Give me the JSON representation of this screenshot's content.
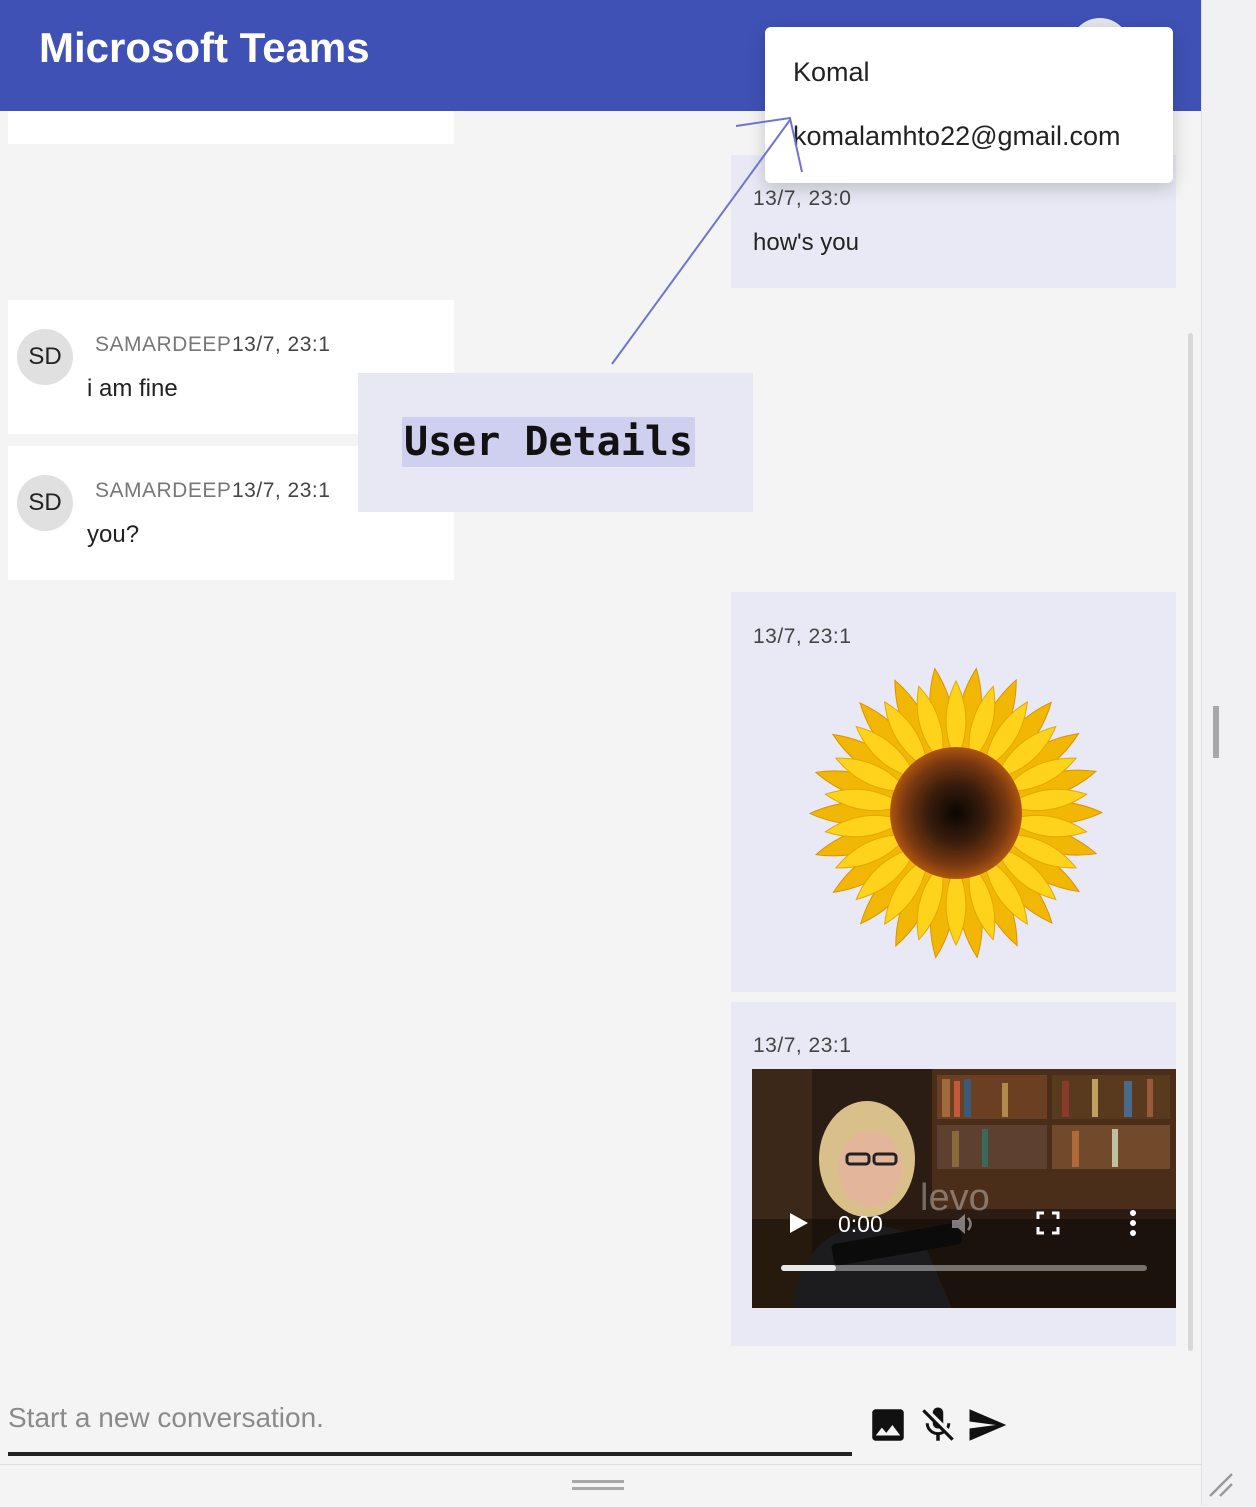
{
  "header": {
    "title": "Microsoft Teams"
  },
  "user_popup": {
    "name": "Komal",
    "email": "komalamhto22@gmail.com"
  },
  "annotation": {
    "label": "User Details"
  },
  "messages": [
    {
      "direction": "outgoing",
      "time": "13/7, 23:0",
      "text": "how's you"
    },
    {
      "direction": "incoming",
      "initials": "SD",
      "sender": "SAMARDEEP",
      "time": "13/7, 23:1",
      "text": "i am fine"
    },
    {
      "direction": "incoming",
      "initials": "SD",
      "sender": "SAMARDEEP",
      "time": "13/7, 23:1",
      "text": "you?"
    },
    {
      "direction": "outgoing",
      "time": "13/7, 23:1",
      "attachment": "sunflower-image"
    },
    {
      "direction": "outgoing",
      "time": "13/7, 23:1",
      "attachment": "video",
      "video": {
        "current_time": "0:00",
        "watermark": "levo",
        "progress": 0.15
      }
    }
  ],
  "composer": {
    "placeholder": "Start a new conversation.",
    "value": "",
    "icons": [
      "image-icon",
      "mic-off-icon",
      "send-icon"
    ]
  },
  "colors": {
    "header": "#3f51b5",
    "outgoing_bubble": "#e9e9f6",
    "incoming_bubble": "#ffffff",
    "background": "#f4f4f4",
    "annotation_line": "#6f74cc"
  }
}
